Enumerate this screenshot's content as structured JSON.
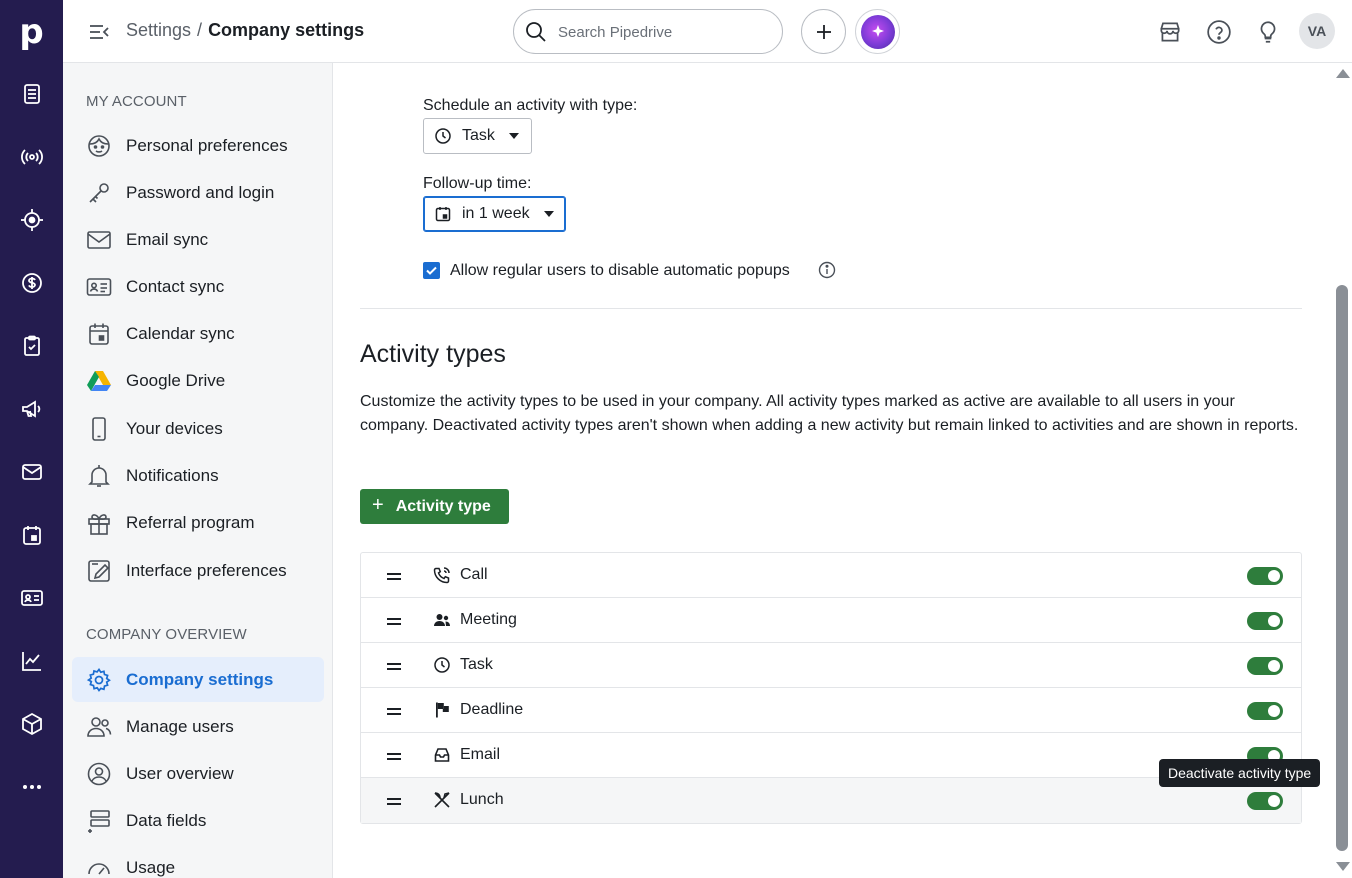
{
  "app": {
    "logo_letter": "p"
  },
  "topbar": {
    "breadcrumb_root": "Settings",
    "breadcrumb_sep": "/",
    "breadcrumb_current": "Company settings",
    "search_placeholder": "Search Pipedrive",
    "avatar_initials": "VA"
  },
  "sidebar": {
    "section_account": "MY ACCOUNT",
    "section_company": "COMPANY OVERVIEW",
    "account_items": [
      {
        "label": "Personal preferences",
        "icon": "face-icon"
      },
      {
        "label": "Password and login",
        "icon": "key-icon"
      },
      {
        "label": "Email sync",
        "icon": "envelope-icon"
      },
      {
        "label": "Contact sync",
        "icon": "contact-card-icon"
      },
      {
        "label": "Calendar sync",
        "icon": "calendar-icon"
      },
      {
        "label": "Google Drive",
        "icon": "google-drive-icon"
      },
      {
        "label": "Your devices",
        "icon": "phone-icon"
      },
      {
        "label": "Notifications",
        "icon": "bell-icon"
      },
      {
        "label": "Referral program",
        "icon": "gift-icon"
      },
      {
        "label": "Interface preferences",
        "icon": "pencil-square-icon"
      }
    ],
    "company_items": [
      {
        "label": "Company settings",
        "icon": "gear-icon",
        "active": true
      },
      {
        "label": "Manage users",
        "icon": "users-icon"
      },
      {
        "label": "User overview",
        "icon": "user-circle-icon"
      },
      {
        "label": "Data fields",
        "icon": "data-fields-icon"
      },
      {
        "label": "Usage",
        "icon": "gauge-icon"
      }
    ]
  },
  "main": {
    "schedule_label": "Schedule an activity with type:",
    "schedule_value": "Task",
    "followup_label": "Follow-up time:",
    "followup_value": "in 1 week",
    "checkbox_label": "Allow regular users to disable automatic popups",
    "checkbox_checked": true,
    "activity_heading": "Activity types",
    "activity_desc": "Customize the activity types to be used in your company. All activity types marked as active are available to all users in your company. Deactivated activity types aren't shown when adding a new activity but remain linked to activities and are shown in reports.",
    "add_button": "Activity type",
    "activity_types": [
      {
        "name": "Call",
        "icon": "phone-call-icon",
        "active": true
      },
      {
        "name": "Meeting",
        "icon": "people-icon",
        "active": true
      },
      {
        "name": "Task",
        "icon": "clock-icon",
        "active": true
      },
      {
        "name": "Deadline",
        "icon": "flag-icon",
        "active": true
      },
      {
        "name": "Email",
        "icon": "inbox-icon",
        "active": true
      },
      {
        "name": "Lunch",
        "icon": "utensils-icon",
        "active": true
      }
    ],
    "tooltip": "Deactivate activity type"
  },
  "colors": {
    "rail": "#241c4f",
    "accent_blue": "#1a6dd1",
    "toggle_green": "#2e7d3c"
  }
}
